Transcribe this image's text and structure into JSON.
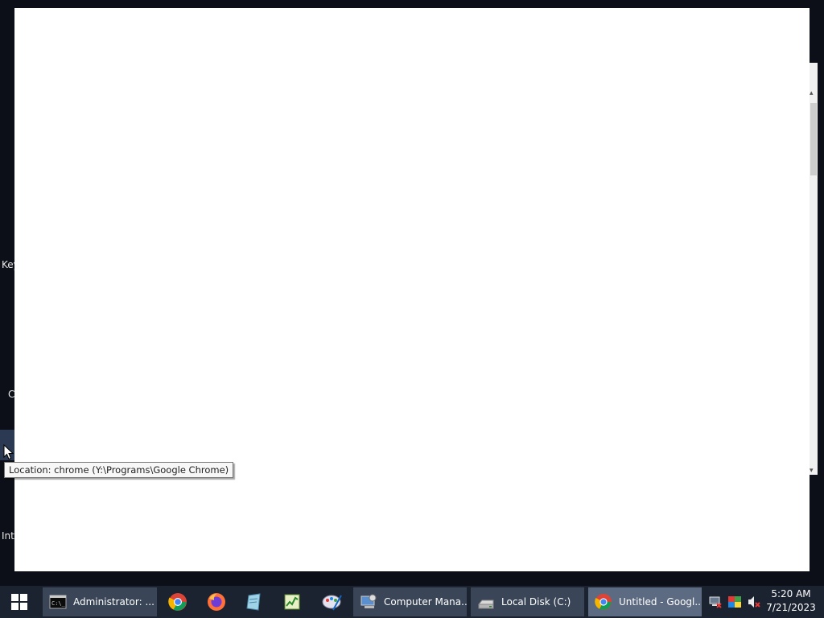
{
  "desktop": {
    "labels": [
      "Key",
      "C",
      "Int"
    ]
  },
  "tooltip": {
    "text": "Location: chrome (Y:\\Programs\\Google Chrome)"
  },
  "taskbar": {
    "tasks": [
      {
        "label": "Administrator: ...",
        "icon": "cmd-icon"
      },
      {
        "label": "Computer Mana...",
        "icon": "computer-management-icon"
      },
      {
        "label": "Local Disk (C:)",
        "icon": "drive-icon"
      },
      {
        "label": "Untitled - Googl...",
        "icon": "chrome-icon",
        "active": true
      }
    ],
    "pinned": [
      "chrome-icon",
      "firefox-icon",
      "notepad-icon",
      "task-manager-icon",
      "paint-icon"
    ],
    "tray": [
      "network-icon",
      "color-icon",
      "volume-muted-icon"
    ],
    "clock": {
      "time": "5:20 AM",
      "date": "7/21/2023"
    }
  }
}
